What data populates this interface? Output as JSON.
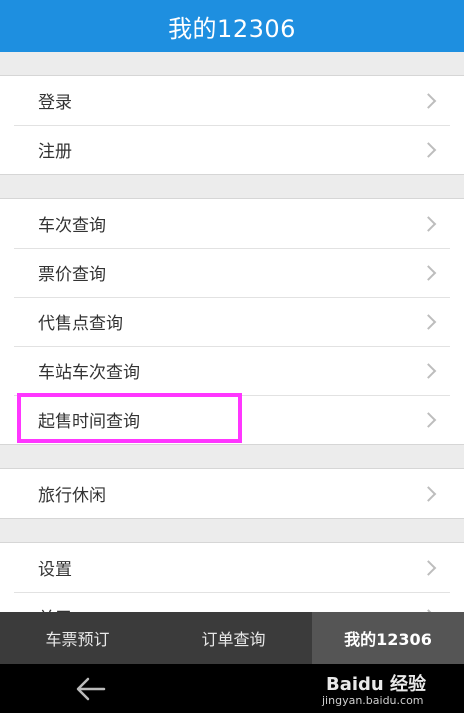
{
  "header": {
    "title": "我的12306"
  },
  "groups": [
    {
      "items": [
        "登录",
        "注册"
      ]
    },
    {
      "items": [
        "车次查询",
        "票价查询",
        "代售点查询",
        "车站车次查询",
        "起售时间查询"
      ]
    },
    {
      "items": [
        "旅行休闲"
      ]
    },
    {
      "items": [
        "设置",
        "关于"
      ]
    }
  ],
  "tabs": [
    {
      "label": "车票预订"
    },
    {
      "label": "订单查询"
    },
    {
      "label": "我的12306"
    }
  ],
  "watermark": {
    "brand": "Baidu 经验",
    "site": "jingyan.baidu.com"
  },
  "colors": {
    "accent": "#1e8fe0",
    "highlight": "#ff36ff",
    "tabbar": "#3b3b3b"
  }
}
